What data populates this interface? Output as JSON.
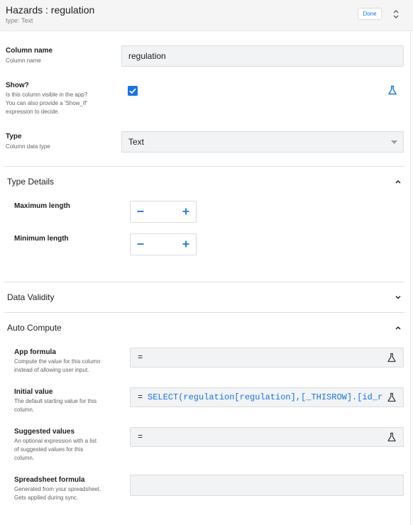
{
  "header": {
    "title": "Hazards : regulation",
    "subtitle": "type: Text",
    "done_label": "Done"
  },
  "column_name": {
    "label": "Column name",
    "desc": "Column name",
    "value": "regulation"
  },
  "show": {
    "label": "Show?",
    "desc_lines": [
      "Is this column visible in the app?",
      "You can also provide a 'Show_If'",
      "expression to decide."
    ],
    "checked": true
  },
  "type": {
    "label": "Type",
    "desc": "Column data type",
    "value": "Text"
  },
  "type_details": {
    "title": "Type Details",
    "max_label": "Maximum length",
    "min_label": "Minimum length"
  },
  "data_validity": {
    "title": "Data Validity"
  },
  "auto_compute": {
    "title": "Auto Compute",
    "app_formula": {
      "label": "App formula",
      "desc_lines": [
        "Compute the value for this column",
        "instead of allowing user input."
      ],
      "value": ""
    },
    "initial_value": {
      "label": "Initial value",
      "desc_lines": [
        "The default starting value for this",
        "column."
      ],
      "value": "SELECT(regulation[regulation],[_THISROW].[id_r"
    },
    "suggested_values": {
      "label": "Suggested values",
      "desc_lines": [
        "An optional expression with a list",
        "of suggested values for this",
        "column."
      ],
      "value": ""
    },
    "spreadsheet_formula": {
      "label": "Spreadsheet formula",
      "desc_lines": [
        "Generated from your spreadsheet.",
        "Gets applied during sync."
      ],
      "value": ""
    },
    "equals_sign": "="
  },
  "colors": {
    "accent": "#1a73e8",
    "field_bg": "#f1f3f4",
    "header_bg": "#f5f5f5"
  },
  "icons": [
    "up-down-arrows-icon",
    "flask-icon",
    "dropdown-arrow-icon",
    "chevron-up-icon",
    "chevron-down-icon",
    "minus-icon",
    "plus-icon",
    "checkmark-icon"
  ]
}
